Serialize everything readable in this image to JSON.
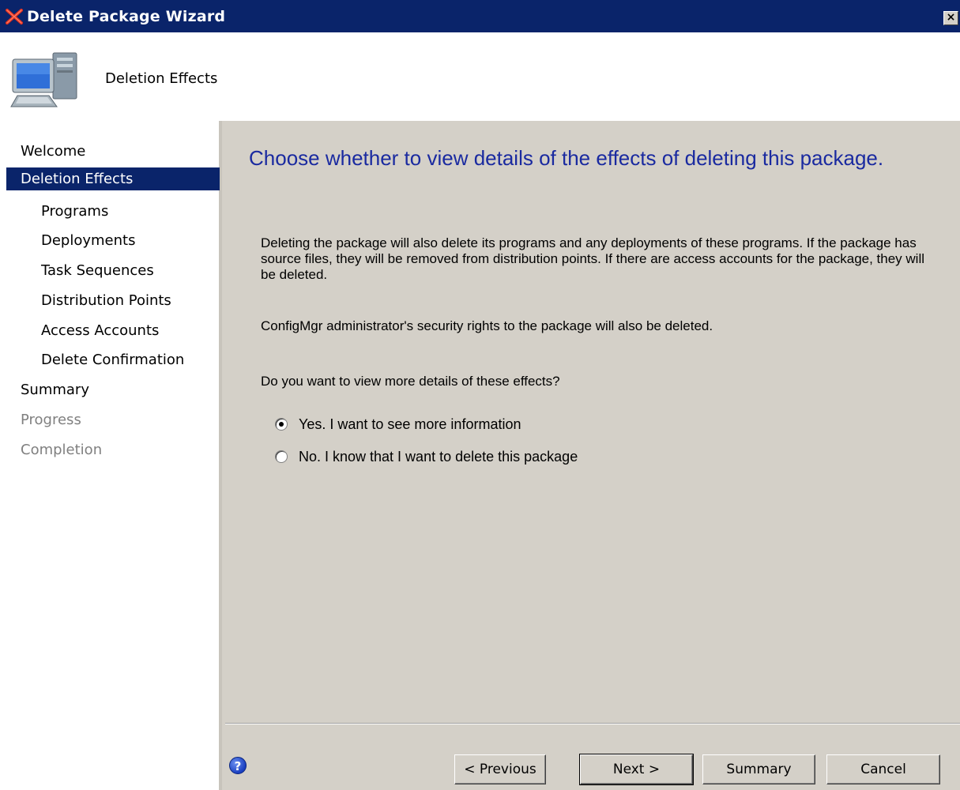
{
  "window": {
    "title": "Delete Package Wizard",
    "close_label": "×"
  },
  "header": {
    "title": "Deletion Effects"
  },
  "sidebar": {
    "items": [
      {
        "label": "Welcome"
      },
      {
        "label": "Deletion Effects"
      },
      {
        "label": "Programs"
      },
      {
        "label": "Deployments"
      },
      {
        "label": "Task Sequences"
      },
      {
        "label": "Distribution Points"
      },
      {
        "label": "Access Accounts"
      },
      {
        "label": "Delete Confirmation"
      },
      {
        "label": "Summary"
      },
      {
        "label": "Progress"
      },
      {
        "label": "Completion"
      }
    ]
  },
  "main": {
    "heading": "Choose whether to view details of the effects of deleting this package.",
    "paragraph1": "Deleting the package will also delete its programs and any deployments of these programs. If the package has source files, they will be removed from distribution points. If there are access accounts for the package, they will be deleted.",
    "paragraph2": "ConfigMgr administrator's security rights to the package will also be deleted.",
    "question": "Do you want to view more details of these effects?",
    "options": [
      {
        "label": "Yes. I want to see more information",
        "checked": true
      },
      {
        "label": "No. I know that I want to delete this package",
        "checked": false
      }
    ]
  },
  "footer": {
    "help_label": "?",
    "previous_label": "< Previous",
    "next_label": "Next >",
    "summary_label": "Summary",
    "cancel_label": "Cancel"
  },
  "colors": {
    "titlebar": "#0a246a",
    "heading": "#1a2aa0",
    "selection": "#0a246a"
  }
}
